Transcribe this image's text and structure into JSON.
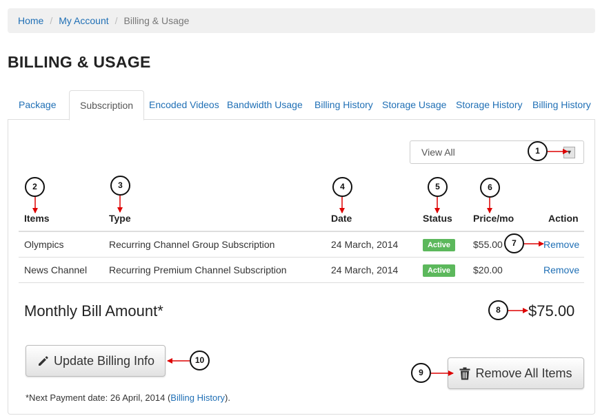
{
  "breadcrumb": {
    "home": "Home",
    "account": "My Account",
    "current": "Billing & Usage"
  },
  "page": {
    "title": "BILLING & USAGE"
  },
  "tabs": [
    {
      "label": "Package"
    },
    {
      "label": "Subscription"
    },
    {
      "label": "Encoded Videos"
    },
    {
      "label": "Bandwidth Usage"
    },
    {
      "label": "Billing History"
    },
    {
      "label": "Storage Usage"
    },
    {
      "label": "Storage History"
    },
    {
      "label": "Billing History"
    }
  ],
  "filter": {
    "selected": "View All"
  },
  "table": {
    "headers": {
      "items": "Items",
      "type": "Type",
      "date": "Date",
      "status": "Status",
      "price": "Price/mo",
      "action": "Action"
    },
    "rows": [
      {
        "item": "Olympics",
        "type": "Recurring Channel Group Subscription",
        "date": "24 March, 2014",
        "status": "Active",
        "price": "$55.00",
        "action": "Remove"
      },
      {
        "item": "News Channel",
        "type": "Recurring Premium Channel Subscription",
        "date": "24 March, 2014",
        "status": "Active",
        "price": "$20.00",
        "action": "Remove"
      }
    ]
  },
  "summary": {
    "label": "Monthly Bill Amount*",
    "amount": "$75.00"
  },
  "buttons": {
    "update": "Update Billing Info",
    "remove_all": "Remove All Items"
  },
  "note": {
    "prefix": "*Next Payment date: 26 April, 2014 (",
    "link": "Billing History",
    "suffix": ")."
  },
  "callouts": [
    "1",
    "2",
    "3",
    "4",
    "5",
    "6",
    "7",
    "8",
    "9",
    "10"
  ],
  "colors": {
    "link": "#1f6fb5",
    "active_badge": "#5cb85c",
    "arrow": "#dd0000"
  }
}
